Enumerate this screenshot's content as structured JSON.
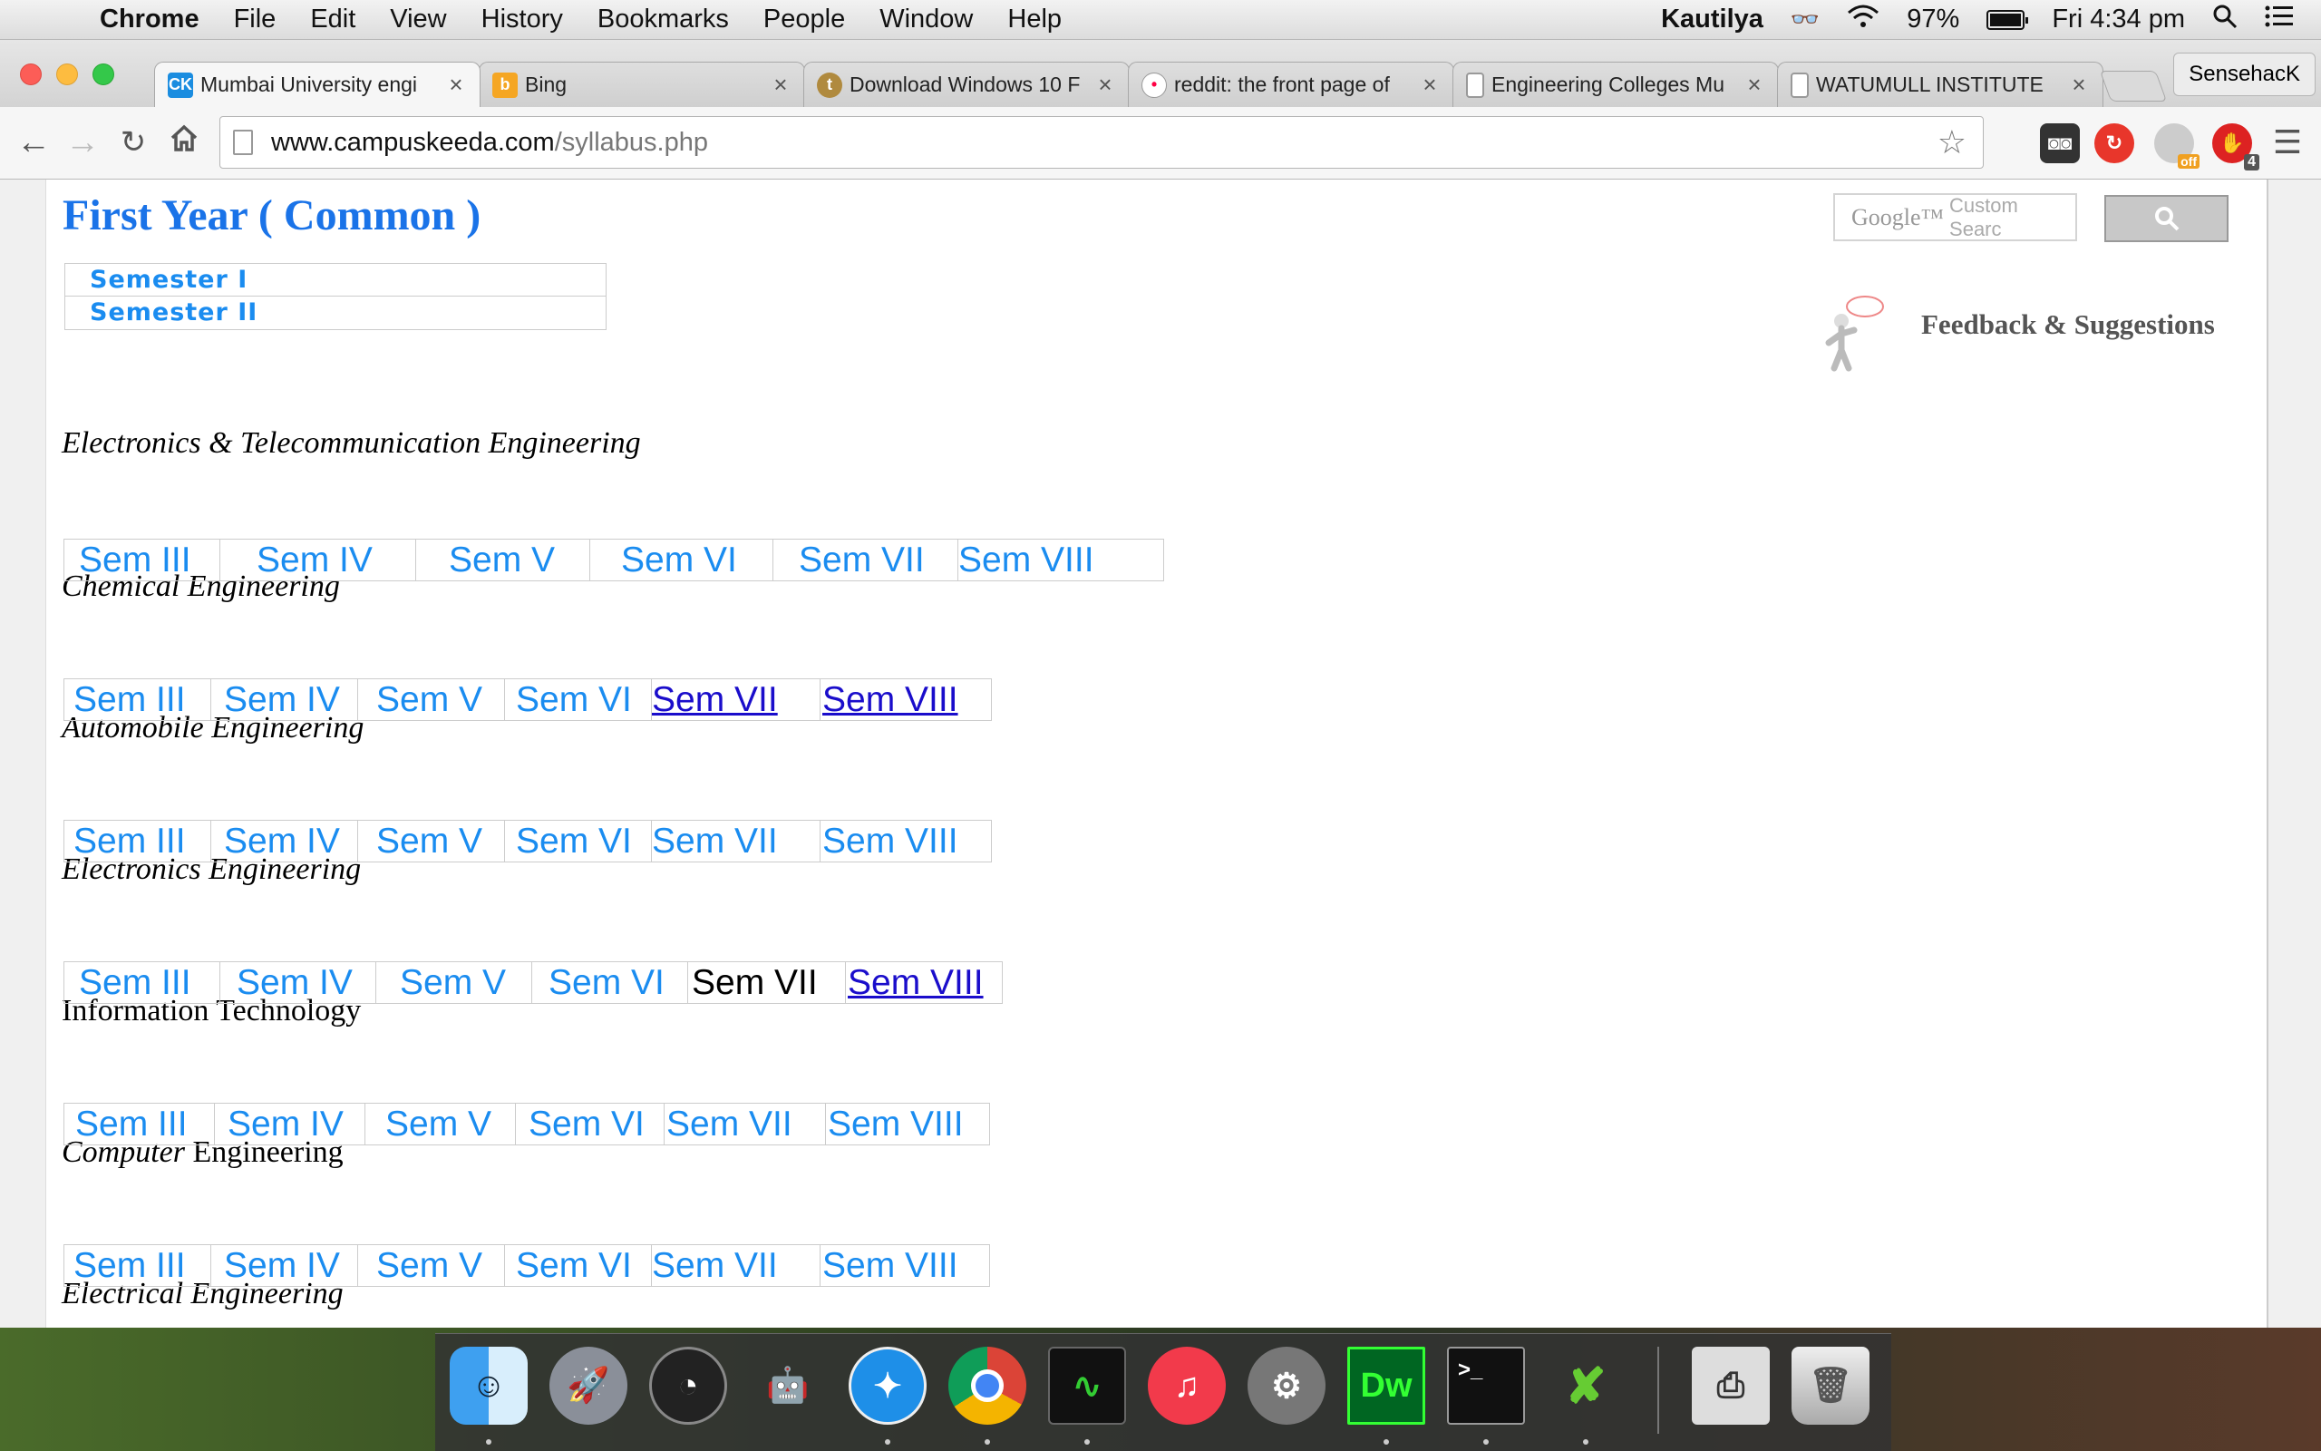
{
  "menubar": {
    "app_name": "Chrome",
    "menus": [
      "File",
      "Edit",
      "View",
      "History",
      "Bookmarks",
      "People",
      "Window",
      "Help"
    ],
    "user": "Kautilya",
    "battery": "97%",
    "clock": "Fri 4:34 pm"
  },
  "tabs": [
    {
      "title": "Mumbai University engi",
      "active": true
    },
    {
      "title": "Bing"
    },
    {
      "title": "Download Windows 10 F"
    },
    {
      "title": "reddit: the front page of"
    },
    {
      "title": "Engineering Colleges Mu"
    },
    {
      "title": "WATUMULL INSTITUTE"
    }
  ],
  "profile_name": "SensehacK",
  "omnibox": {
    "host": "www.campuskeeda.com",
    "path": "/syllabus.php"
  },
  "extension_badge": "4",
  "extension_off_label": "off",
  "page": {
    "title": "First Year ( Common )",
    "semesters": [
      "Semester  I",
      "Semester  II"
    ],
    "search_placeholder": "Custom Searc",
    "search_logo": "Google™",
    "feedback": "Feedback & Suggestions",
    "branches": [
      {
        "name_italic": "Electronics & Telecommunication Engineering",
        "name_plain": "",
        "sems": [
          "Sem III",
          "Sem IV",
          "Sem V",
          "Sem VI",
          "Sem VII",
          "Sem VIII"
        ]
      },
      {
        "name_italic": "Chemical Engineering",
        "name_plain": "",
        "sems": [
          "Sem III",
          "Sem IV",
          "Sem V",
          "Sem VI",
          "Sem VII",
          "Sem VIII"
        ]
      },
      {
        "name_italic": "Automobile Engineering",
        "name_plain": "",
        "sems": [
          "Sem III",
          "Sem IV",
          "Sem V",
          "Sem VI",
          "Sem VII",
          "Sem VIII"
        ]
      },
      {
        "name_italic": "Electronics Engineering",
        "name_plain": "",
        "sems": [
          "Sem III",
          "Sem IV",
          "Sem V",
          "Sem VI",
          "Sem VII",
          "Sem VIII"
        ]
      },
      {
        "name_italic": "",
        "name_plain": "Information Technology",
        "sems": [
          "Sem III",
          "Sem IV",
          "Sem V",
          "Sem VI",
          "Sem VII",
          "Sem VIII"
        ]
      },
      {
        "name_italic": "Computer",
        "name_plain": " Engineering",
        "sems": [
          "Sem III",
          "Sem IV",
          "Sem V",
          "Sem VI",
          "Sem VII",
          "Sem VIII"
        ]
      },
      {
        "name_italic": "Electrical Engineering",
        "name_plain": "",
        "sems": []
      }
    ]
  },
  "dock": [
    "Finder",
    "Launchpad",
    "Dashboard",
    "Automator",
    "Safari",
    "Chrome",
    "Activity Monitor",
    "iTunes",
    "System Preferences",
    "Dreamweaver",
    "Terminal",
    "Xmarks",
    "Printer",
    "Trash"
  ],
  "dock_dw_label": "Dw",
  "dock_term_label": ">_",
  "colors": {
    "link": "#1a8cf0",
    "visited": "#1a0dcb",
    "title": "#1a73e8"
  }
}
